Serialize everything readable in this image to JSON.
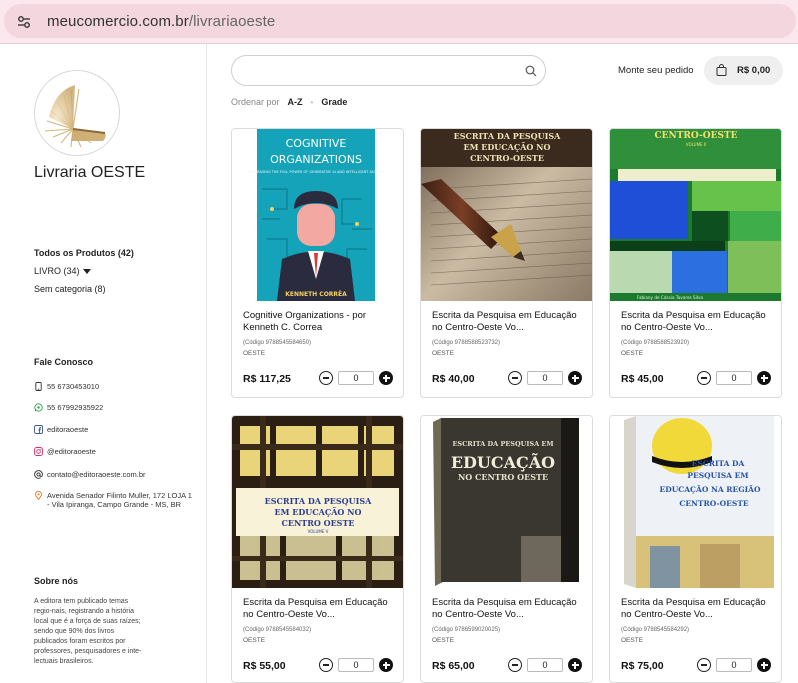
{
  "browser": {
    "url_host": "meucomercio.com.br",
    "url_path": "/livrariaoeste"
  },
  "store": {
    "name": "Livraria OESTE"
  },
  "sidebar": {
    "categories": [
      {
        "label": "Todos os Produtos (42)"
      },
      {
        "label": "LIVRO (34)"
      },
      {
        "label": "Sem categoria (8)"
      }
    ],
    "contact_title": "Fale Conosco",
    "contacts": [
      {
        "icon": "phone-icon",
        "text": "55 6730453010"
      },
      {
        "icon": "whatsapp-icon",
        "text": "55 67992935922"
      },
      {
        "icon": "facebook-icon",
        "text": "editoraoeste"
      },
      {
        "icon": "instagram-icon",
        "text": "@editoraoeste"
      },
      {
        "icon": "at-icon",
        "text": "contato@editoraoeste.com.br"
      },
      {
        "icon": "location-pin-icon",
        "text": "Avenida Senador Filinto Muller, 172 LOJA 1 - Vila Ipiranga, Campo Grande - MS, BR"
      }
    ],
    "about_title": "Sobre nós",
    "about_text": "A editora tem publicado temas regio-nais, registrando a história local que é a força de suas raízes; sendo que 90% dos livros publicados foram escritos por professores, pesquisadores e inte-lectuais brasileiros."
  },
  "header": {
    "search_placeholder": "",
    "order_link": "Monte seu pedido",
    "cart_total": "R$ 0,00"
  },
  "sort": {
    "label": "Ordenar por",
    "option1": "A-Z",
    "option2": "Grade"
  },
  "products": [
    {
      "title": "Cognitive Organizations - por Kenneth C. Correa",
      "code": "(Código 9788545584650)",
      "publisher": "OESTE",
      "price": "R$ 117,25",
      "qty": "0",
      "cover_title": "COGNITIVE ORGANIZATIONS",
      "cover_sub": "LEVERAGING THE FULL POWER OF GENERATIVE AI AND INTELLIGENT AGENTS",
      "cover_author": "KENNETH CORRÊA"
    },
    {
      "title": "Escrita da Pesquisa em Educação no Centro-Oeste Vo...",
      "code": "(Código 9788588523732)",
      "publisher": "OESTE",
      "price": "R$ 40,00",
      "qty": "0",
      "cover_title": "ESCRITA DA PESQUISA EM EDUCAÇÃO NO CENTRO-OESTE"
    },
    {
      "title": "Escrita da Pesquisa em Educação no Centro-Oeste Vo...",
      "code": "(Código 9788588523920)",
      "publisher": "OESTE",
      "price": "R$ 45,00",
      "qty": "0",
      "cover_title": "CENTRO-OESTE",
      "cover_vol": "VOLUME II",
      "cover_bottom": "Fabiany de Cássia Tavares Silva"
    },
    {
      "title": "Escrita da Pesquisa em Educação no Centro-Oeste Vo...",
      "code": "(Código 9788545584032)",
      "publisher": "OESTE",
      "price": "R$ 55,00",
      "qty": "0",
      "cover_title": "ESCRITA DA PESQUISA EM EDUCAÇÃO NO CENTRO OESTE",
      "cover_vol": "VOLUME V"
    },
    {
      "title": "Escrita da Pesquisa em Educação no Centro-Oeste Vo...",
      "code": "(Código 9786599020025)",
      "publisher": "OESTE",
      "price": "R$ 65,00",
      "qty": "0",
      "cover_title": "ESCRITA DA PESQUISA EM",
      "cover_big": "EDUCAÇÃO",
      "cover_title2": "NO CENTRO OESTE"
    },
    {
      "title": "Escrita da Pesquisa em Educação no Centro-Oeste Vo...",
      "code": "(Código 9788545584292)",
      "publisher": "OESTE",
      "price": "R$ 75,00",
      "qty": "0",
      "cover_title": "ESCRITA DA PESQUISA EM EDUCAÇÃO NA REGIÃO CENTRO-OESTE"
    }
  ]
}
